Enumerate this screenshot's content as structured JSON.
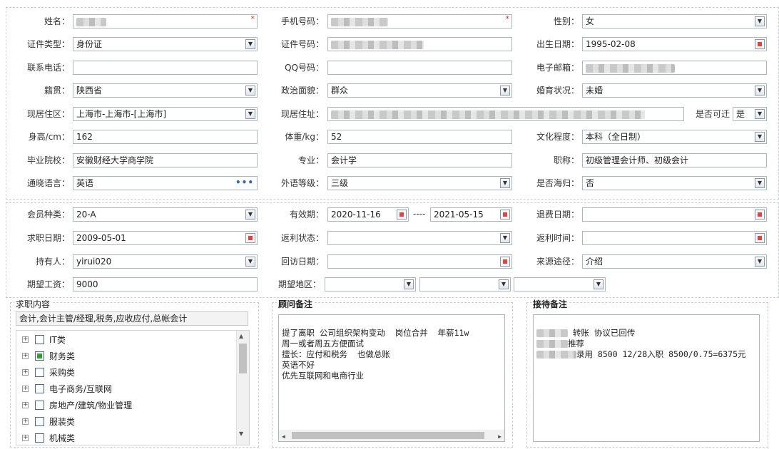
{
  "personal": {
    "name": {
      "label": "姓名：",
      "value": ""
    },
    "mobile": {
      "label": "手机号码：",
      "value": ""
    },
    "gender": {
      "label": "性别：",
      "value": "女"
    },
    "id_type": {
      "label": "证件类型：",
      "value": "身份证"
    },
    "id_number": {
      "label": "证件号码：",
      "value": ""
    },
    "birth_date": {
      "label": "出生日期：",
      "value": "1995-02-08"
    },
    "phone": {
      "label": "联系电话：",
      "value": ""
    },
    "qq": {
      "label": "QQ号码：",
      "value": ""
    },
    "email": {
      "label": "电子邮箱：",
      "value": ""
    },
    "native_place": {
      "label": "籍贯：",
      "value": "陕西省"
    },
    "political": {
      "label": "政治面貌：",
      "value": "群众"
    },
    "marital": {
      "label": "婚育状况：",
      "value": "未婚"
    },
    "current_area": {
      "label": "现居住区：",
      "value": "上海市-上海市-[上海市]"
    },
    "current_address": {
      "label": "现居住址：",
      "value": ""
    },
    "relocate": {
      "label": "是否可迁",
      "value": "是"
    },
    "height": {
      "label": "身高/cm：",
      "value": "162"
    },
    "weight": {
      "label": "体重/kg：",
      "value": "52"
    },
    "education": {
      "label": "文化程度：",
      "value": "本科（全日制）"
    },
    "school": {
      "label": "毕业院校：",
      "value": "安徽财经大学商学院"
    },
    "major": {
      "label": "专业：",
      "value": "会计学"
    },
    "title": {
      "label": "职称：",
      "value": "初级管理会计师、初级会计"
    },
    "language": {
      "label": "通晓语言：",
      "value": "英语"
    },
    "lang_level": {
      "label": "外语等级：",
      "value": "三级"
    },
    "overseas": {
      "label": "是否海归：",
      "value": "否"
    }
  },
  "membership": {
    "member_type": {
      "label": "会员种类：",
      "value": "20-A"
    },
    "validity": {
      "label": "有效期：",
      "start": "2020-11-16",
      "sep": "----",
      "end": "2021-05-15"
    },
    "refund_date": {
      "label": "退费日期：",
      "value": ""
    },
    "job_date": {
      "label": "求职日期：",
      "value": "2009-05-01"
    },
    "rebate_status": {
      "label": "返利状态：",
      "value": ""
    },
    "rebate_time": {
      "label": "返利时间：",
      "value": ""
    },
    "holder": {
      "label": "持有人：",
      "value": "yirui020"
    },
    "visit_date": {
      "label": "回访日期：",
      "value": ""
    },
    "source": {
      "label": "来源途径：",
      "value": "介绍"
    },
    "salary": {
      "label": "期望工资：",
      "value": "9000"
    },
    "region": {
      "label": "期望地区：",
      "value": ""
    }
  },
  "job_content": {
    "title": "求职内容",
    "summary": "会计,会计主管/经理,税务,应收应付,总帐会计",
    "tree": [
      {
        "label": "IT类",
        "checked": false
      },
      {
        "label": "财务类",
        "checked": true
      },
      {
        "label": "采购类",
        "checked": false
      },
      {
        "label": "电子商务/互联网",
        "checked": false
      },
      {
        "label": "房地产/建筑/物业管理",
        "checked": false
      },
      {
        "label": "服装类",
        "checked": false
      },
      {
        "label": "机械类",
        "checked": false
      }
    ]
  },
  "advisor_notes": {
    "title": "顾问备注",
    "lines": [
      "提了离职 公司组织架构变动  岗位合并  年薪11w",
      "周一或者周五方便面试",
      "擅长：应付和税务  也做总账",
      "英语不好",
      "优先互联网和电商行业"
    ]
  },
  "reception_notes": {
    "title": "接待备注",
    "lines": [
      " 转账 协议已回传",
      "推荐",
      "录用 8500 12/28入职 8500/0.75=6375元"
    ]
  },
  "icons": {
    "dropdown": "chevron-down-icon",
    "calendar": "calendar-icon",
    "more": "ellipsis-icon",
    "expand": "plus-square-icon",
    "scroll_up": "triangle-up-icon",
    "scroll_down": "triangle-down-icon",
    "scroll_left": "triangle-left-icon",
    "scroll_right": "triangle-right-icon"
  },
  "glyphs": {
    "dropdown": "▼",
    "expand": "+",
    "scroll_up": "▲",
    "scroll_down": "▼",
    "scroll_left": "◀",
    "scroll_right": "▶",
    "more": "•••"
  },
  "colors": {
    "required": "#e03030",
    "border": "#a9b6c3",
    "checked": "#3a9a3a",
    "frame": "#c9cfd6"
  }
}
